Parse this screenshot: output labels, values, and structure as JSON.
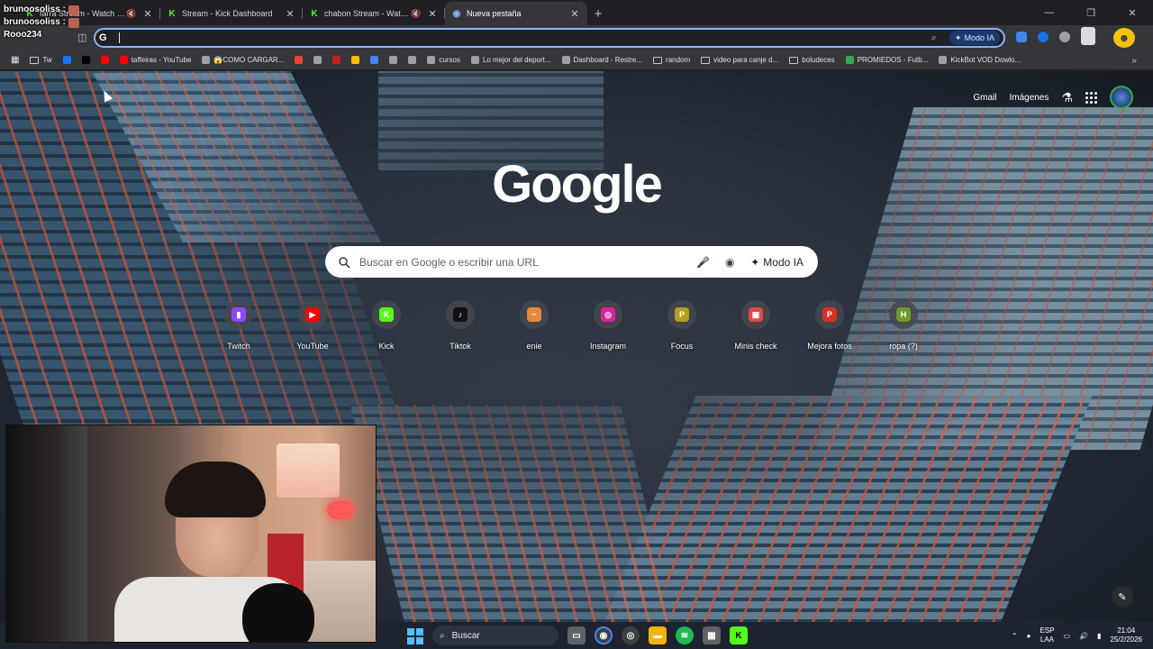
{
  "tabs": [
    {
      "title": "farra Stream - Watch Live o",
      "favicon_color": "#53fc18",
      "muted": true,
      "active": false
    },
    {
      "title": "Stream - Kick Dashboard",
      "favicon_color": "#53fc18",
      "muted": false,
      "active": false
    },
    {
      "title": "chabon Stream - Watch Live",
      "favicon_color": "#53fc18",
      "muted": true,
      "active": false
    },
    {
      "title": "Nueva pestaña",
      "favicon_color": "#8ab4f8",
      "muted": false,
      "active": true
    }
  ],
  "overlay_chat": {
    "line1": "brunoosoliss :",
    "line2": "brunoosoliss :",
    "line3": "Rooo234"
  },
  "omnibox": {
    "value": "",
    "modo_ia": "Modo IA"
  },
  "bookmarks": [
    {
      "label": "Tw",
      "type": "folder"
    },
    {
      "label": "",
      "color": "#1877f2"
    },
    {
      "label": "",
      "color": "#000000"
    },
    {
      "label": "",
      "color": "#ff0000"
    },
    {
      "label": "taffeiras - YouTube",
      "color": "#ff0000"
    },
    {
      "label": "😱COMO CARGAR...",
      "color": "#9aa0a6"
    },
    {
      "label": "",
      "color": "#ea4335"
    },
    {
      "label": "",
      "color": "#9aa0a6"
    },
    {
      "label": "",
      "color": "#c5221f"
    },
    {
      "label": "",
      "color": "#fbbc04"
    },
    {
      "label": "",
      "color": "#4285f4"
    },
    {
      "label": "",
      "color": "#9aa0a6"
    },
    {
      "label": "",
      "color": "#9aa0a6"
    },
    {
      "label": "cursos",
      "color": "#9aa0a6"
    },
    {
      "label": "Lo mejor del deport...",
      "color": "#9aa0a6"
    },
    {
      "label": "Dashboard - Restre...",
      "color": "#9aa0a6"
    },
    {
      "label": "random",
      "type": "folder"
    },
    {
      "label": "video para canje d...",
      "type": "folder"
    },
    {
      "label": "boludeces",
      "type": "folder"
    },
    {
      "label": "PROMIEDOS - Futb...",
      "color": "#34a853"
    },
    {
      "label": "KickBot VOD Dowlo...",
      "color": "#9aa0a6"
    }
  ],
  "google": {
    "gmail": "Gmail",
    "images": "Imágenes",
    "logo": "Google",
    "search_placeholder": "Buscar en Google o escribir una URL",
    "modo_ia": "Modo IA"
  },
  "shortcuts": [
    {
      "label": "Twitch",
      "icon": "twitch-icon",
      "color": "#9146ff",
      "glyph": "▮"
    },
    {
      "label": "YouTube",
      "icon": "youtube-icon",
      "color": "#ff0000",
      "glyph": "▶"
    },
    {
      "label": "Kick",
      "icon": "kick-icon",
      "color": "#53fc18",
      "glyph": "K"
    },
    {
      "label": "Tiktok",
      "icon": "tiktok-icon",
      "color": "#111111",
      "glyph": "♪"
    },
    {
      "label": "enie",
      "icon": "enie-icon",
      "color": "#e8883a",
      "glyph": "~"
    },
    {
      "label": "Instagram",
      "icon": "instagram-icon",
      "color": "#d6249f",
      "glyph": "◎"
    },
    {
      "label": "Focus",
      "icon": "focus-icon",
      "color": "#b5a01e",
      "glyph": "P"
    },
    {
      "label": "Minis check",
      "icon": "minis-check-icon",
      "color": "#e04a4a",
      "glyph": "▣"
    },
    {
      "label": "Mejora fotos",
      "icon": "mejora-fotos-icon",
      "color": "#d93025",
      "glyph": "P"
    },
    {
      "label": "ropa (?)",
      "icon": "ropa-icon",
      "color": "#6f9a30",
      "glyph": "H"
    }
  ],
  "taskbar": {
    "search_label": "Buscar",
    "lang_top": "ESP",
    "lang_bottom": "LAA",
    "time": "21:04",
    "date": "25/2/2026"
  }
}
